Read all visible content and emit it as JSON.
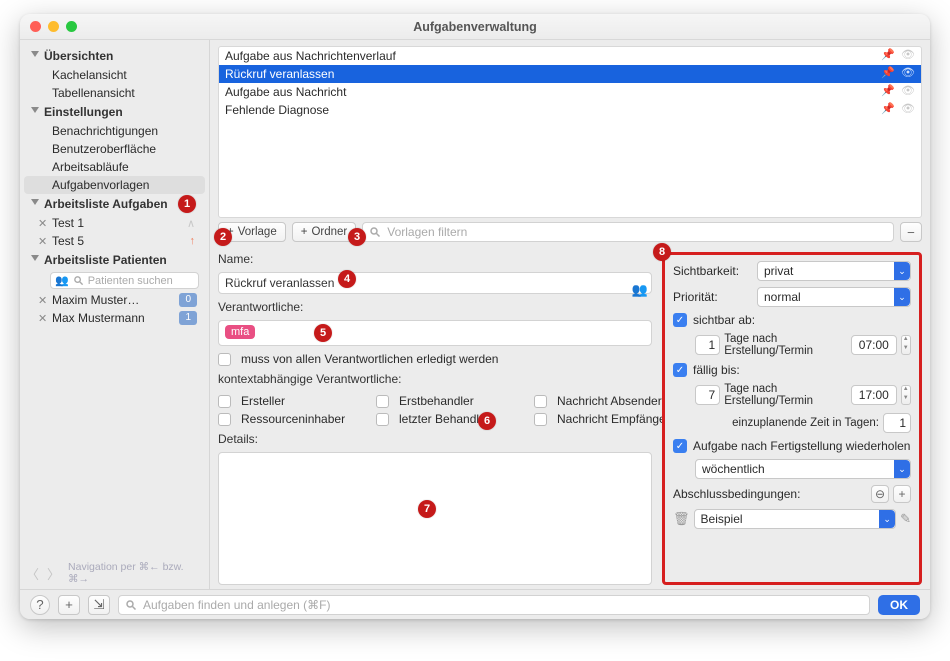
{
  "window": {
    "title": "Aufgabenverwaltung"
  },
  "sidebar": {
    "groups": [
      {
        "label": "Übersichten",
        "items": [
          "Kachelansicht",
          "Tabellenansicht"
        ]
      },
      {
        "label": "Einstellungen",
        "items": [
          "Benachrichtigungen",
          "Benutzeroberfläche",
          "Arbeitsabläufe",
          "Aufgabenvorlagen"
        ]
      },
      {
        "label": "Arbeitsliste Aufgaben",
        "items": [
          "Test 1",
          "Test 5"
        ]
      },
      {
        "label": "Arbeitsliste Patienten",
        "items": []
      }
    ],
    "patient_search_placeholder": "Patienten suchen",
    "patients": [
      {
        "name": "Maxim Muster…",
        "count": "0"
      },
      {
        "name": "Max Mustermann",
        "count": "1"
      }
    ],
    "nav_hint": "Navigation per ⌘← bzw. ⌘→"
  },
  "templates": {
    "items": [
      "Aufgabe aus Nachrichtenverlauf",
      "Rückruf veranlassen",
      "Aufgabe aus Nachricht",
      "Fehlende Diagnose"
    ],
    "selected_index": 1,
    "add_template": "Vorlage",
    "add_folder": "Ordner",
    "filter_placeholder": "Vorlagen filtern"
  },
  "form": {
    "name_label": "Name:",
    "name_value": "Rückruf veranlassen",
    "responsible_label": "Verantwortliche:",
    "responsible_tag": "mfa",
    "must_all_label": "muss von allen Verantwortlichen erledigt werden",
    "context_label": "kontextabhängige Verantwortliche:",
    "context_opts": [
      "Ersteller",
      "Erstbehandler",
      "Nachricht Absender",
      "Ressourceninhaber",
      "letzter Behandler",
      "Nachricht Empfänger"
    ],
    "details_label": "Details:"
  },
  "settings": {
    "visibility_label": "Sichtbarkeit:",
    "visibility_value": "privat",
    "priority_label": "Priorität:",
    "priority_value": "normal",
    "visible_from_label": "sichtbar ab:",
    "visible_from_days": "1",
    "days_after_label": "Tage nach Erstellung/Termin",
    "visible_from_time": "07:00",
    "due_label": "fällig bis:",
    "due_days": "7",
    "due_time": "17:00",
    "plan_label": "einzuplanende Zeit in Tagen:",
    "plan_days": "1",
    "repeat_label": "Aufgabe nach Fertigstellung wiederholen",
    "repeat_value": "wöchentlich",
    "conditions_label": "Abschlussbedingungen:",
    "condition_value": "Beispiel"
  },
  "footer": {
    "search_placeholder": "Aufgaben finden und anlegen (⌘F)",
    "ok": "OK"
  },
  "annotations": [
    "1",
    "2",
    "3",
    "4",
    "5",
    "6",
    "7",
    "8"
  ]
}
